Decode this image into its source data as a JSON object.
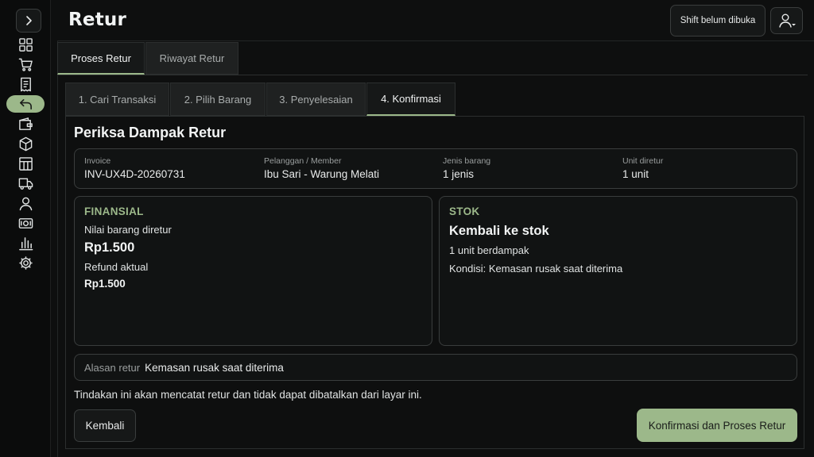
{
  "header": {
    "title": "Retur",
    "shift_label": "Shift belum dibuka"
  },
  "sidebar": {
    "items": [
      {
        "icon": "dashboard-grid-icon"
      },
      {
        "icon": "cart-icon"
      },
      {
        "icon": "receipt-icon"
      },
      {
        "icon": "return-arrow-icon",
        "active": true
      },
      {
        "icon": "wallet-icon"
      },
      {
        "icon": "box-icon"
      },
      {
        "icon": "table-icon"
      },
      {
        "icon": "truck-icon"
      },
      {
        "icon": "user-icon"
      },
      {
        "icon": "cash-icon"
      },
      {
        "icon": "bar-chart-icon"
      },
      {
        "icon": "gear-icon"
      }
    ]
  },
  "tabs": [
    {
      "label": "Proses Retur",
      "active": true
    },
    {
      "label": "Riwayat Retur",
      "active": false
    }
  ],
  "steps": [
    {
      "label": "1. Cari Transaksi"
    },
    {
      "label": "2. Pilih Barang"
    },
    {
      "label": "3. Penyelesaian"
    },
    {
      "label": "4. Konfirmasi",
      "active": true
    }
  ],
  "section_title": "Periksa Dampak Retur",
  "info": {
    "invoice": {
      "label": "Invoice",
      "value": "INV-UX4D-20260731"
    },
    "customer": {
      "label": "Pelanggan / Member",
      "value": "Ibu Sari - Warung Melati"
    },
    "item_types": {
      "label": "Jenis barang",
      "value": "1 jenis"
    },
    "units": {
      "label": "Unit diretur",
      "value": "1 unit"
    }
  },
  "financial": {
    "kicker": "FINANSIAL",
    "returned_value_label": "Nilai barang diretur",
    "returned_value": "Rp1.500",
    "refund_label": "Refund aktual",
    "refund_value": "Rp1.500"
  },
  "stock": {
    "kicker": "STOK",
    "heading": "Kembali ke stok",
    "affected": "1 unit berdampak",
    "condition": "Kondisi: Kemasan rusak saat diterima"
  },
  "reason": {
    "label": "Alasan retur",
    "value": "Kemasan rusak saat diterima"
  },
  "warning": "Tindakan ini akan mencatat retur dan tidak dapat dibatalkan dari layar ini.",
  "actions": {
    "back_label": "Kembali",
    "confirm_label": "Konfirmasi dan Proses Retur"
  },
  "colors": {
    "accent": "#9cb88a",
    "background": "#0e0f0f",
    "panel": "#111313"
  }
}
